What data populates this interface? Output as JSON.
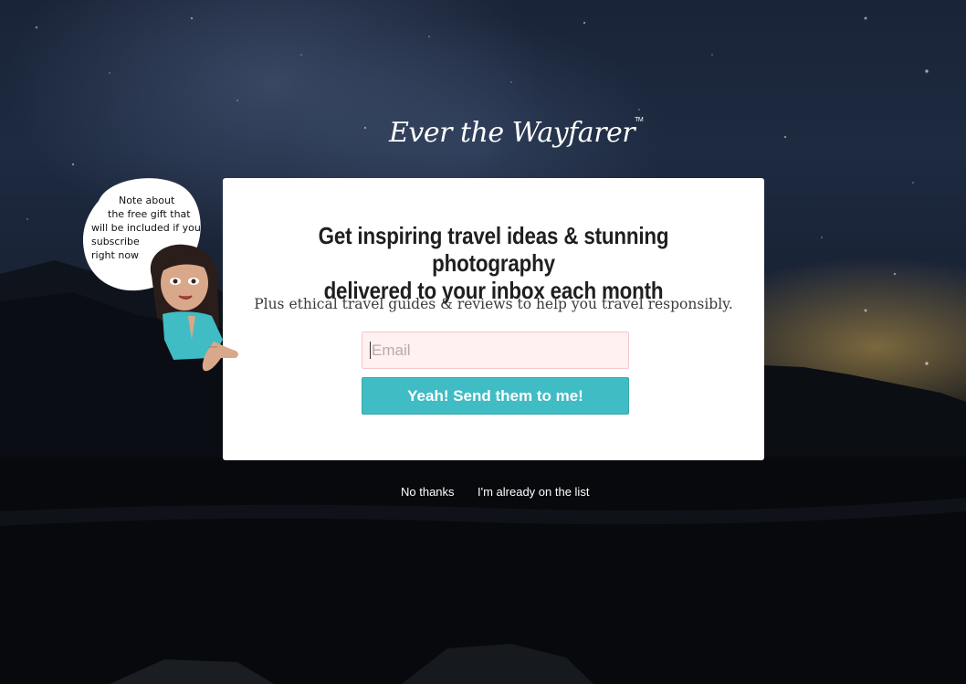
{
  "brand": {
    "logo_text": "Ever the Wayfarer",
    "trademark": "TM"
  },
  "popup": {
    "headline_line1": "Get inspiring travel ideas & stunning photography",
    "headline_line2": "delivered to your inbox each month",
    "subheading": "Plus ethical travel guides & reviews to help you travel responsibly.",
    "email_placeholder": "Email",
    "email_value": "",
    "submit_label": "Yeah! Send them to me!"
  },
  "footer_links": {
    "no_thanks": "No thanks",
    "already_on_list": "I'm already on the list"
  },
  "annotation_bubble": {
    "line1": "Note about",
    "line2": "the free gift that",
    "line3": "will be included if you",
    "line4": "subscribe",
    "line5": "right now"
  },
  "colors": {
    "button": "#3fbcc4",
    "input_background": "#fff0f1",
    "card_background": "#ffffff"
  },
  "icons": {
    "avatar": "cartoon-woman-pointing-icon"
  }
}
